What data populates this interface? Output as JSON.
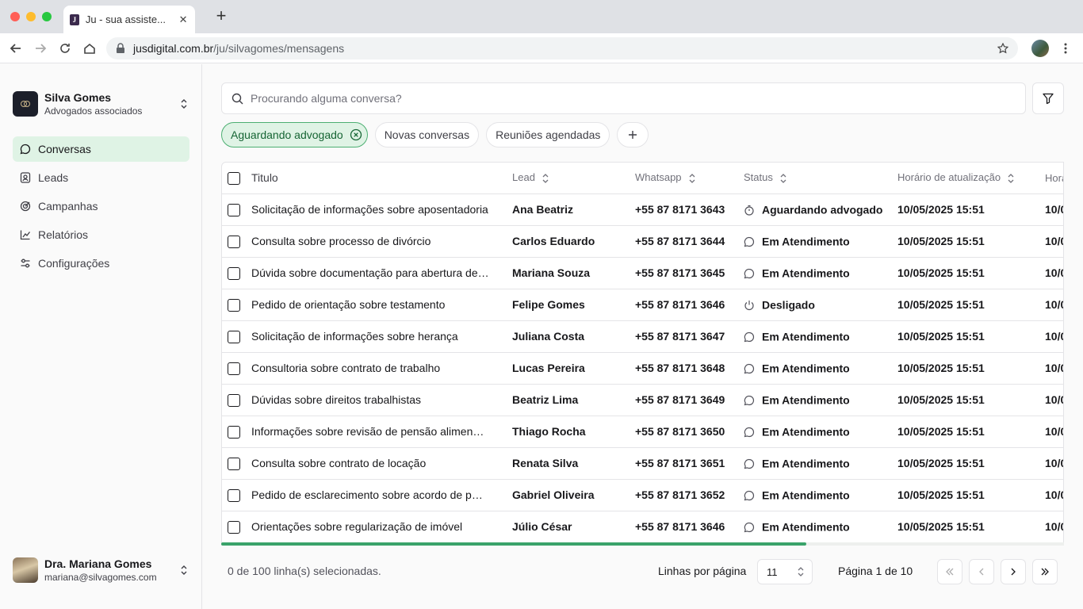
{
  "browser": {
    "tab_title": "Ju - sua assiste...",
    "favicon_letter": "J",
    "url_host": "jusdigital.com.br",
    "url_path": "/ju/silvagomes/mensagens"
  },
  "sidebar": {
    "org_name": "Silva Gomes",
    "org_subtitle": "Advogados associados",
    "items": [
      {
        "label": "Conversas",
        "icon": "chat-icon",
        "active": true
      },
      {
        "label": "Leads",
        "icon": "contact-icon"
      },
      {
        "label": "Campanhas",
        "icon": "target-icon"
      },
      {
        "label": "Relatórios",
        "icon": "chart-icon"
      },
      {
        "label": "Configurações",
        "icon": "sliders-icon"
      }
    ],
    "user_name": "Dra. Mariana Gomes",
    "user_email": "mariana@silvagomes.com"
  },
  "search": {
    "placeholder": "Procurando alguma conversa?"
  },
  "filters": {
    "chips": [
      "Aguardando advogado",
      "Novas conversas",
      "Reuniões agendadas"
    ]
  },
  "table": {
    "columns": {
      "title": "Titulo",
      "lead": "Lead",
      "whatsapp": "Whatsapp",
      "status": "Status",
      "updated": "Horário de atualização",
      "extra": "Hora"
    },
    "rows": [
      {
        "title": "Solicitação de informações sobre aposentadoria",
        "lead": "Ana Beatriz",
        "whatsapp": "+55 87 8171 3643",
        "status": "Aguardando advogado",
        "status_icon": "timer",
        "updated": "10/05/2025 15:51",
        "extra": "10/0"
      },
      {
        "title": "Consulta sobre processo de divórcio",
        "lead": "Carlos Eduardo",
        "whatsapp": "+55 87 8171 3644",
        "status": "Em Atendimento",
        "status_icon": "chat",
        "updated": "10/05/2025 15:51",
        "extra": "10/0"
      },
      {
        "title": "Dúvida sobre documentação para abertura de…",
        "lead": "Mariana Souza",
        "whatsapp": "+55 87 8171 3645",
        "status": "Em Atendimento",
        "status_icon": "chat",
        "updated": "10/05/2025 15:51",
        "extra": "10/0"
      },
      {
        "title": "Pedido de orientação sobre testamento",
        "lead": "Felipe Gomes",
        "whatsapp": "+55 87 8171 3646",
        "status": "Desligado",
        "status_icon": "power",
        "updated": "10/05/2025 15:51",
        "extra": "10/0"
      },
      {
        "title": "Solicitação de informações sobre herança",
        "lead": "Juliana Costa",
        "whatsapp": "+55 87 8171 3647",
        "status": "Em Atendimento",
        "status_icon": "chat",
        "updated": "10/05/2025 15:51",
        "extra": "10/0"
      },
      {
        "title": "Consultoria sobre contrato de trabalho",
        "lead": "Lucas Pereira",
        "whatsapp": "+55 87 8171 3648",
        "status": "Em Atendimento",
        "status_icon": "chat",
        "updated": "10/05/2025 15:51",
        "extra": "10/0"
      },
      {
        "title": "Dúvidas sobre direitos trabalhistas",
        "lead": "Beatriz Lima",
        "whatsapp": "+55 87 8171 3649",
        "status": "Em Atendimento",
        "status_icon": "chat",
        "updated": "10/05/2025 15:51",
        "extra": "10/0"
      },
      {
        "title": "Informações sobre revisão de pensão alimen…",
        "lead": "Thiago Rocha",
        "whatsapp": "+55 87 8171 3650",
        "status": "Em Atendimento",
        "status_icon": "chat",
        "updated": "10/05/2025 15:51",
        "extra": "10/0"
      },
      {
        "title": "Consulta sobre contrato de locação",
        "lead": "Renata Silva",
        "whatsapp": "+55 87 8171 3651",
        "status": "Em Atendimento",
        "status_icon": "chat",
        "updated": "10/05/2025 15:51",
        "extra": "10/0"
      },
      {
        "title": "Pedido de esclarecimento sobre acordo de p…",
        "lead": "Gabriel Oliveira",
        "whatsapp": "+55 87 8171 3652",
        "status": "Em Atendimento",
        "status_icon": "chat",
        "updated": "10/05/2025 15:51",
        "extra": "10/0"
      },
      {
        "title": "Orientações sobre regularização de imóvel",
        "lead": "Júlio César",
        "whatsapp": "+55 87 8171 3646",
        "status": "Em Atendimento",
        "status_icon": "chat",
        "updated": "10/05/2025 15:51",
        "extra": "10/0"
      }
    ]
  },
  "footer": {
    "selected_text": "0 de 100 linha(s) selecionadas.",
    "rows_per_page_label": "Linhas por página",
    "rows_per_page_value": "11",
    "page_text": "Página 1 de 10"
  },
  "colors": {
    "accent": "#3aa36a",
    "active_bg": "#dff3e5"
  }
}
